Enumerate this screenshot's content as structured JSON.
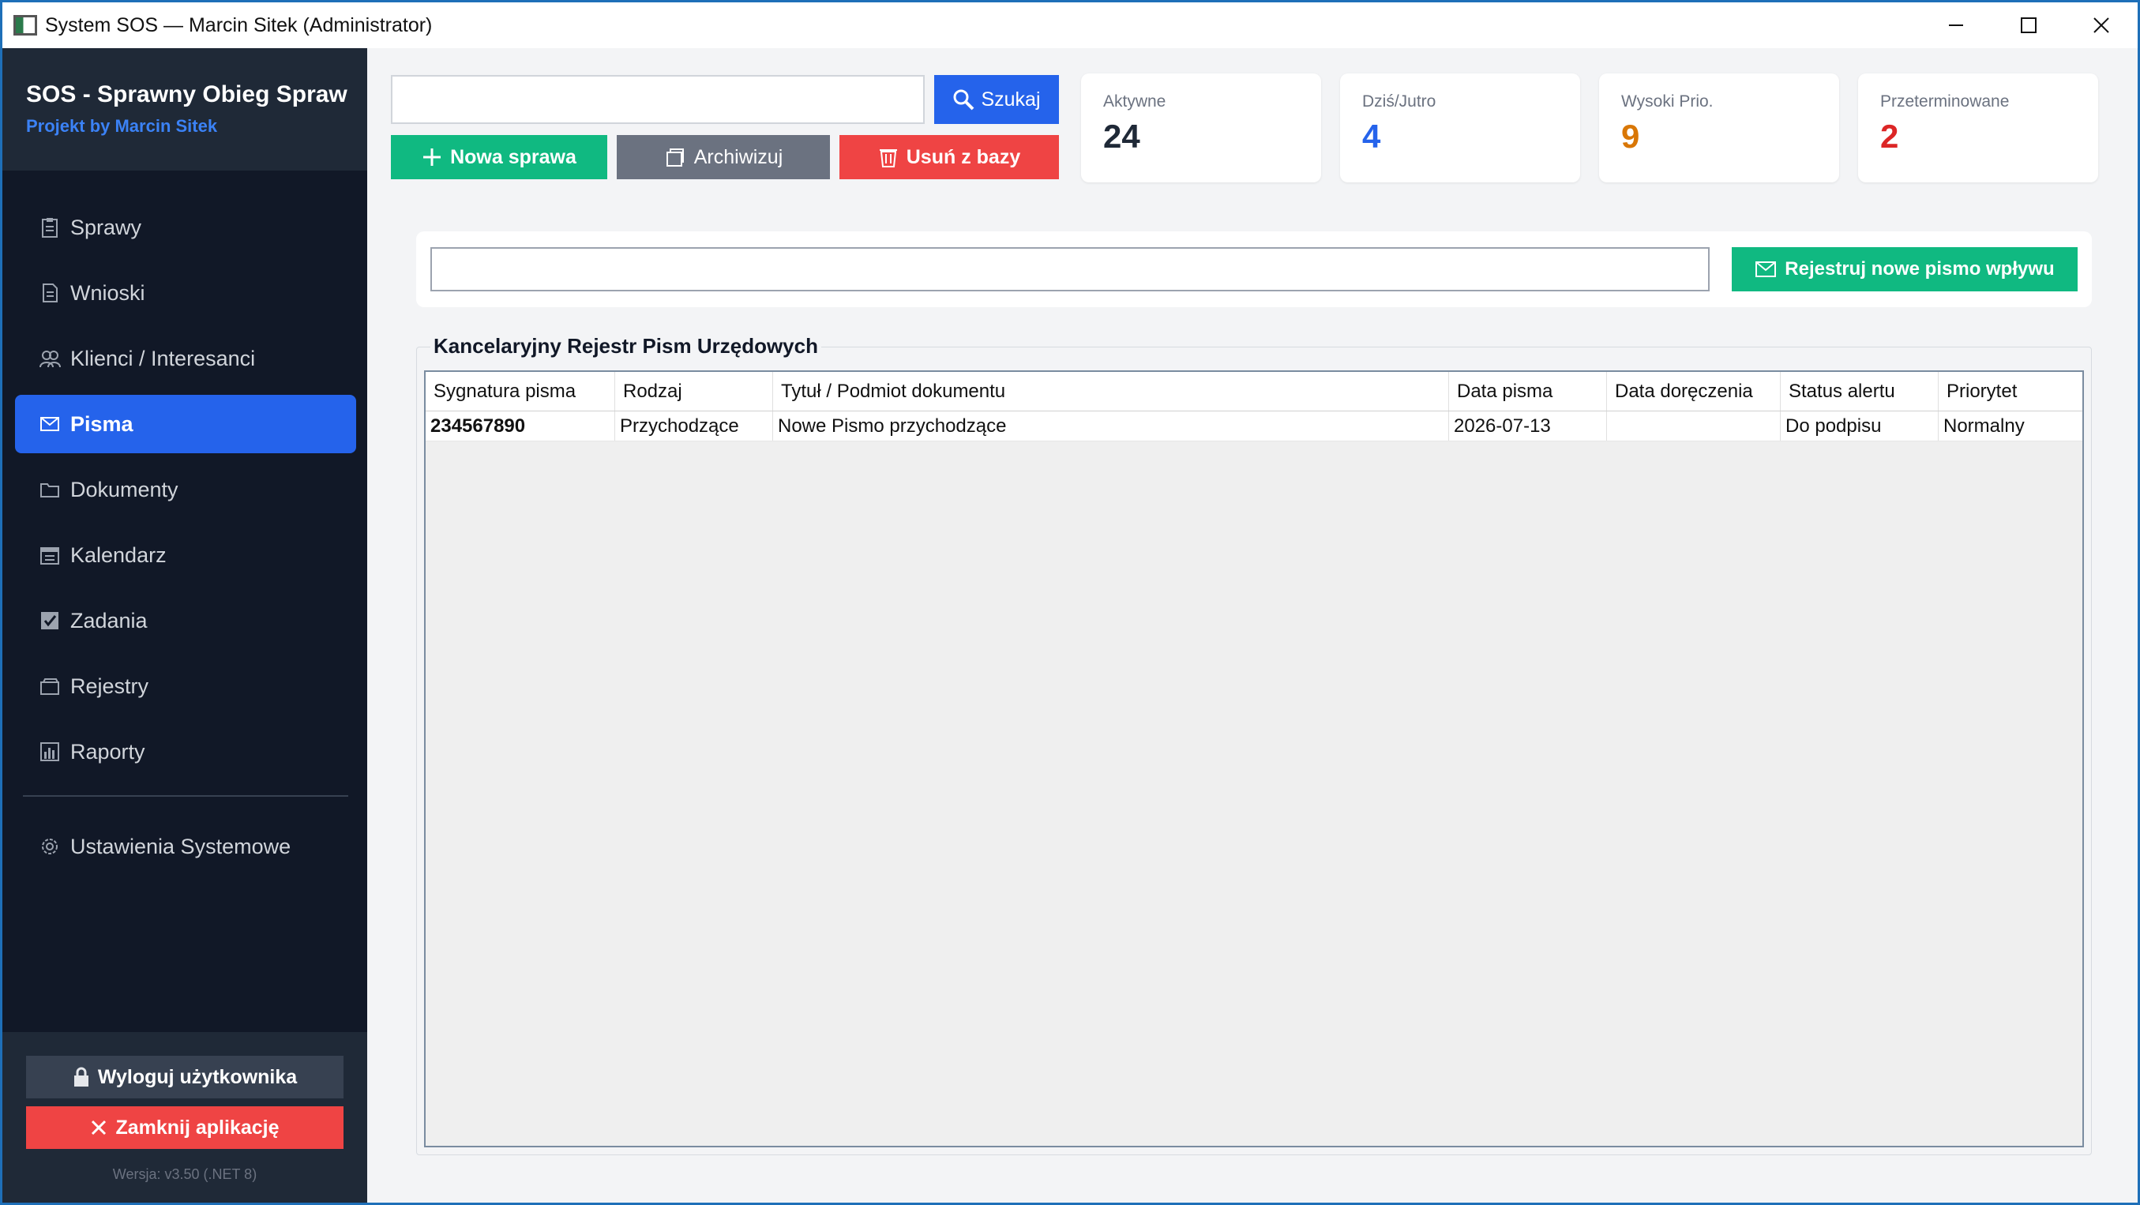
{
  "window": {
    "title": "System SOS — Marcin Sitek (Administrator)"
  },
  "brand": {
    "title": "SOS - Sprawny Obieg Spraw",
    "subtitle": "Projekt by Marcin Sitek"
  },
  "sidebar": {
    "items": [
      {
        "label": "Sprawy",
        "icon": "clipboard-icon"
      },
      {
        "label": "Wnioski",
        "icon": "document-icon"
      },
      {
        "label": "Klienci / Interesanci",
        "icon": "users-icon"
      },
      {
        "label": "Pisma",
        "icon": "envelope-icon",
        "active": true
      },
      {
        "label": "Dokumenty",
        "icon": "folder-icon"
      },
      {
        "label": "Kalendarz",
        "icon": "calendar-icon"
      },
      {
        "label": "Zadania",
        "icon": "checkbox-icon"
      },
      {
        "label": "Rejestry",
        "icon": "card-box-icon"
      },
      {
        "label": "Raporty",
        "icon": "bar-chart-icon"
      }
    ],
    "settings_label": "Ustawienia Systemowe",
    "logout_label": "Wyloguj użytkownika",
    "close_label": "Zamknij aplikację",
    "version": "Wersja: v3.50 (.NET 8)"
  },
  "toolbar": {
    "search_value": "",
    "search_label": "Szukaj",
    "new_label": "Nowa sprawa",
    "archive_label": "Archiwizuj",
    "delete_label": "Usuń z bazy"
  },
  "stats": [
    {
      "label": "Aktywne",
      "value": "24",
      "color": "#1f2937"
    },
    {
      "label": "Dziś/Jutro",
      "value": "4",
      "color": "#2563eb"
    },
    {
      "label": "Wysoki Prio.",
      "value": "9",
      "color": "#d97706"
    },
    {
      "label": "Przeterminowane",
      "value": "2",
      "color": "#dc2626"
    }
  ],
  "register": {
    "input_value": "",
    "button_label": "Rejestruj nowe pismo wpływu"
  },
  "registry": {
    "title": "Kancelaryjny Rejestr Pism Urzędowych",
    "columns": [
      "Sygnatura pisma",
      "Rodzaj",
      "Tytuł / Podmiot dokumentu",
      "Data pisma",
      "Data doręczenia",
      "Status alertu",
      "Priorytet"
    ],
    "rows": [
      [
        "234567890",
        "Przychodzące",
        "Nowe Pismo przychodzące",
        "2026-07-13",
        "",
        "Do podpisu",
        "Normalny"
      ]
    ]
  },
  "colors": {
    "sidebar_bg": "#111827",
    "accent_blue": "#2563eb",
    "accent_green": "#10b981",
    "accent_red": "#ef4444"
  }
}
